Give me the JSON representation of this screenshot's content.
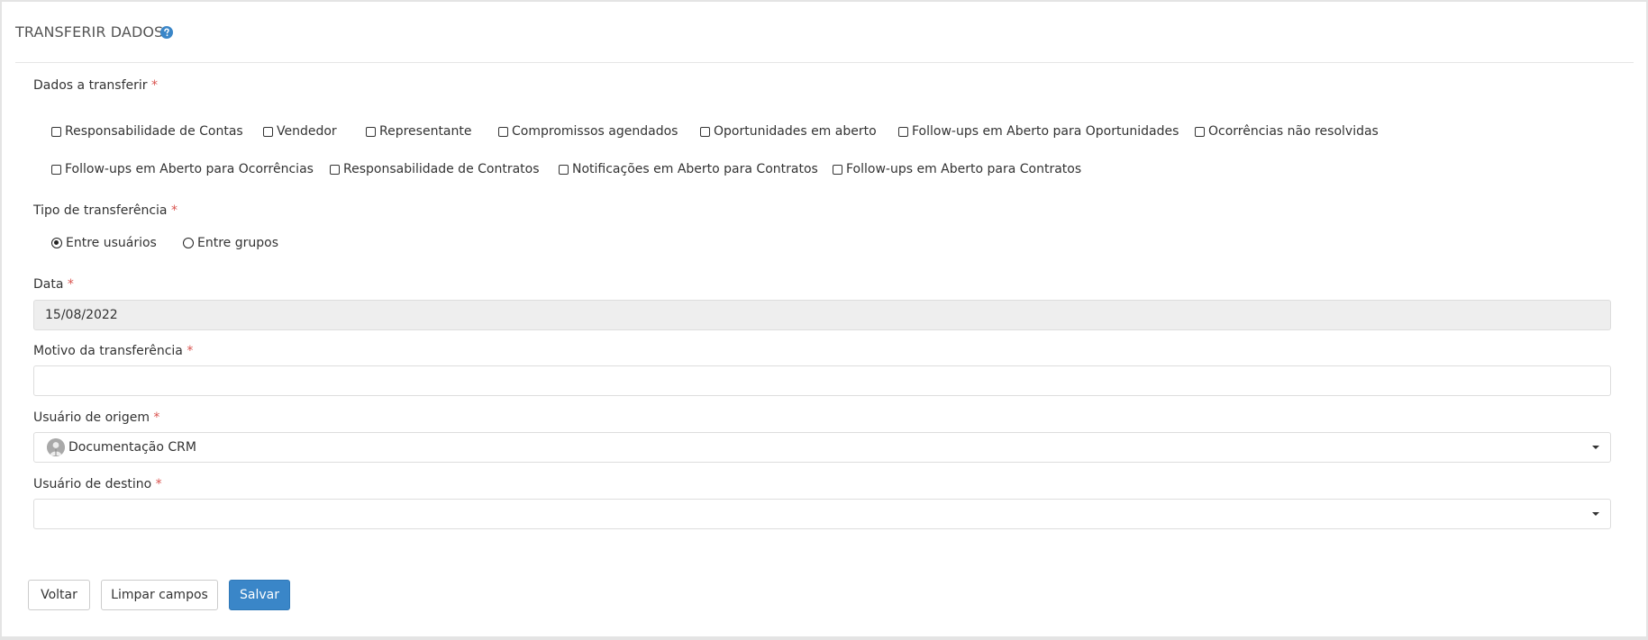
{
  "header": {
    "title": "TRANSFERIR DADOS",
    "help_icon": "question-circle-icon",
    "accent": "#3a86c8"
  },
  "dados": {
    "label": "Dados a transferir",
    "required": "*",
    "options": [
      "Responsabilidade de Contas",
      "Vendedor",
      "Representante",
      "Compromissos agendados",
      "Oportunidades em aberto",
      "Follow-ups em Aberto para Oportunidades",
      "Ocorrências não resolvidas",
      "Follow-ups em Aberto para Ocorrências",
      "Responsabilidade de Contratos",
      "Notificações em Aberto para Contratos",
      "Follow-ups em Aberto para Contratos"
    ]
  },
  "tipo": {
    "label": "Tipo de transferência",
    "required": "*",
    "options": [
      "Entre usuários",
      "Entre grupos"
    ],
    "selected": "Entre usuários"
  },
  "data": {
    "label": "Data",
    "required": "*",
    "value": "15/08/2022"
  },
  "motivo": {
    "label": "Motivo da transferência",
    "required": "*",
    "value": ""
  },
  "origem": {
    "label": "Usuário de origem",
    "required": "*",
    "value": "Documentação CRM"
  },
  "destino": {
    "label": "Usuário de destino",
    "required": "*",
    "value": ""
  },
  "buttons": {
    "back": "Voltar",
    "clear": "Limpar campos",
    "save": "Salvar"
  }
}
